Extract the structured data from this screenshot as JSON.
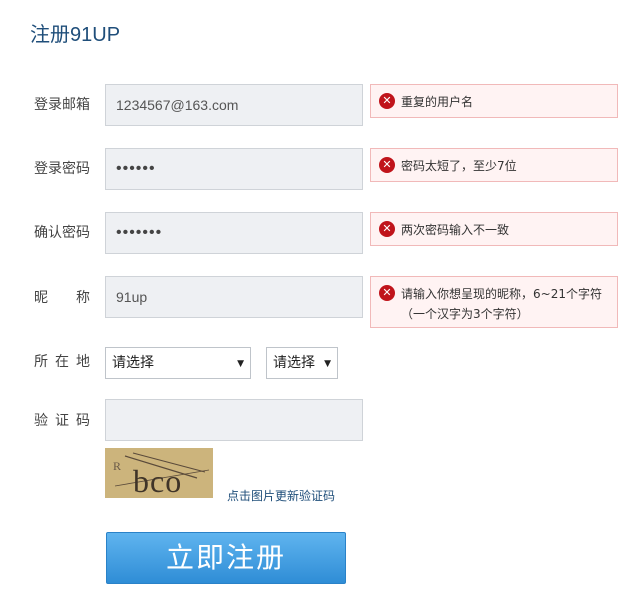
{
  "page": {
    "title": "注册91UP"
  },
  "form": {
    "email": {
      "label": "登录邮箱",
      "value": "1234567@163.com",
      "error": "重复的用户名"
    },
    "password": {
      "label": "登录密码",
      "value": "••••••",
      "error": "密码太短了，至少7位"
    },
    "confirm": {
      "label": "确认密码",
      "value": "•••••••",
      "error": "两次密码输入不一致"
    },
    "nickname": {
      "label_chars": [
        "昵",
        "称"
      ],
      "value": "91up",
      "error_line1": "请输入你想呈现的昵称，6~21个字符",
      "error_line2": "（一个汉字为3个字符）"
    },
    "location": {
      "label_chars": [
        "所",
        "在",
        "地"
      ],
      "province": "请选择",
      "city": "请选择"
    },
    "captcha": {
      "label_chars": [
        "验",
        "证",
        "码"
      ],
      "value": "",
      "image_text": "bco",
      "image_prefix": "R",
      "refresh_text": "点击图片更新验证码"
    },
    "submit_label": "立即注册"
  },
  "icons": {
    "error": "error-x-icon",
    "dropdown": "chevron-down-icon"
  },
  "colors": {
    "accent": "#2f8dd6",
    "error": "#c0141b",
    "title": "#1f4e7a"
  }
}
